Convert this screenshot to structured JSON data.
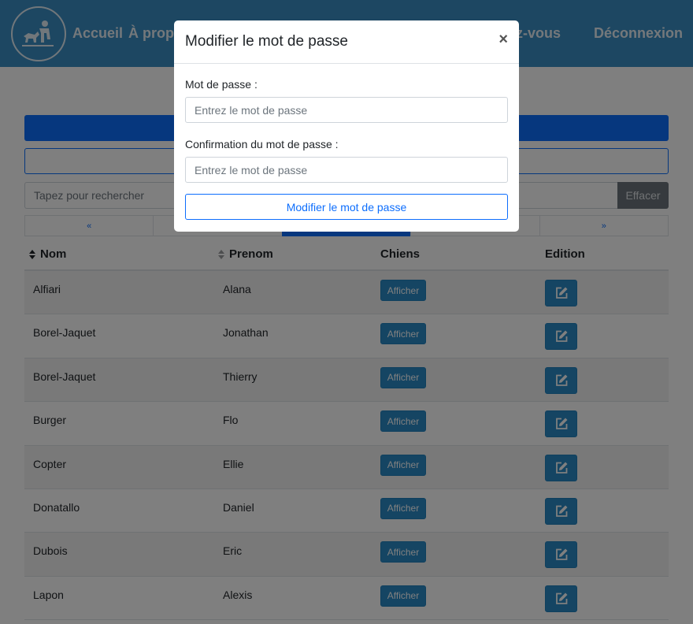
{
  "nav": {
    "logo_icon": "dog-trainer-logo",
    "items": [
      {
        "label": "Accueil"
      },
      {
        "label": "À propos"
      },
      {
        "label": "Rendez-vous"
      },
      {
        "label": "Déconnexion"
      }
    ]
  },
  "search": {
    "placeholder": "Tapez pour rechercher",
    "clear_label": "Effacer"
  },
  "pagination": {
    "prev": "«",
    "next": "»"
  },
  "table": {
    "headers": {
      "nom": "Nom",
      "prenom": "Prenom",
      "chiens": "Chiens",
      "edition": "Edition"
    },
    "button_label": "Afficher",
    "edit_icon": "edit-icon",
    "rows": [
      {
        "nom": "Alfiari",
        "prenom": "Alana"
      },
      {
        "nom": "Borel-Jaquet",
        "prenom": "Jonathan"
      },
      {
        "nom": "Borel-Jaquet",
        "prenom": "Thierry"
      },
      {
        "nom": "Burger",
        "prenom": "Flo"
      },
      {
        "nom": "Copter",
        "prenom": "Ellie"
      },
      {
        "nom": "Donatallo",
        "prenom": "Daniel"
      },
      {
        "nom": "Dubois",
        "prenom": "Eric"
      },
      {
        "nom": "Lapon",
        "prenom": "Alexis"
      }
    ]
  },
  "modal": {
    "title": "Modifier le mot de passe",
    "close": "×",
    "password_label": "Mot de passe :",
    "password_placeholder": "Entrez le mot de passe",
    "confirm_label": "Confirmation du mot de passe :",
    "confirm_placeholder": "Entrez le mot de passe",
    "submit_label": "Modifier le mot de passe"
  },
  "colors": {
    "navbar": "#3a8fc4",
    "primary": "#0d6efd",
    "action_button": "#2a8ac7",
    "secondary": "#6c757d"
  }
}
